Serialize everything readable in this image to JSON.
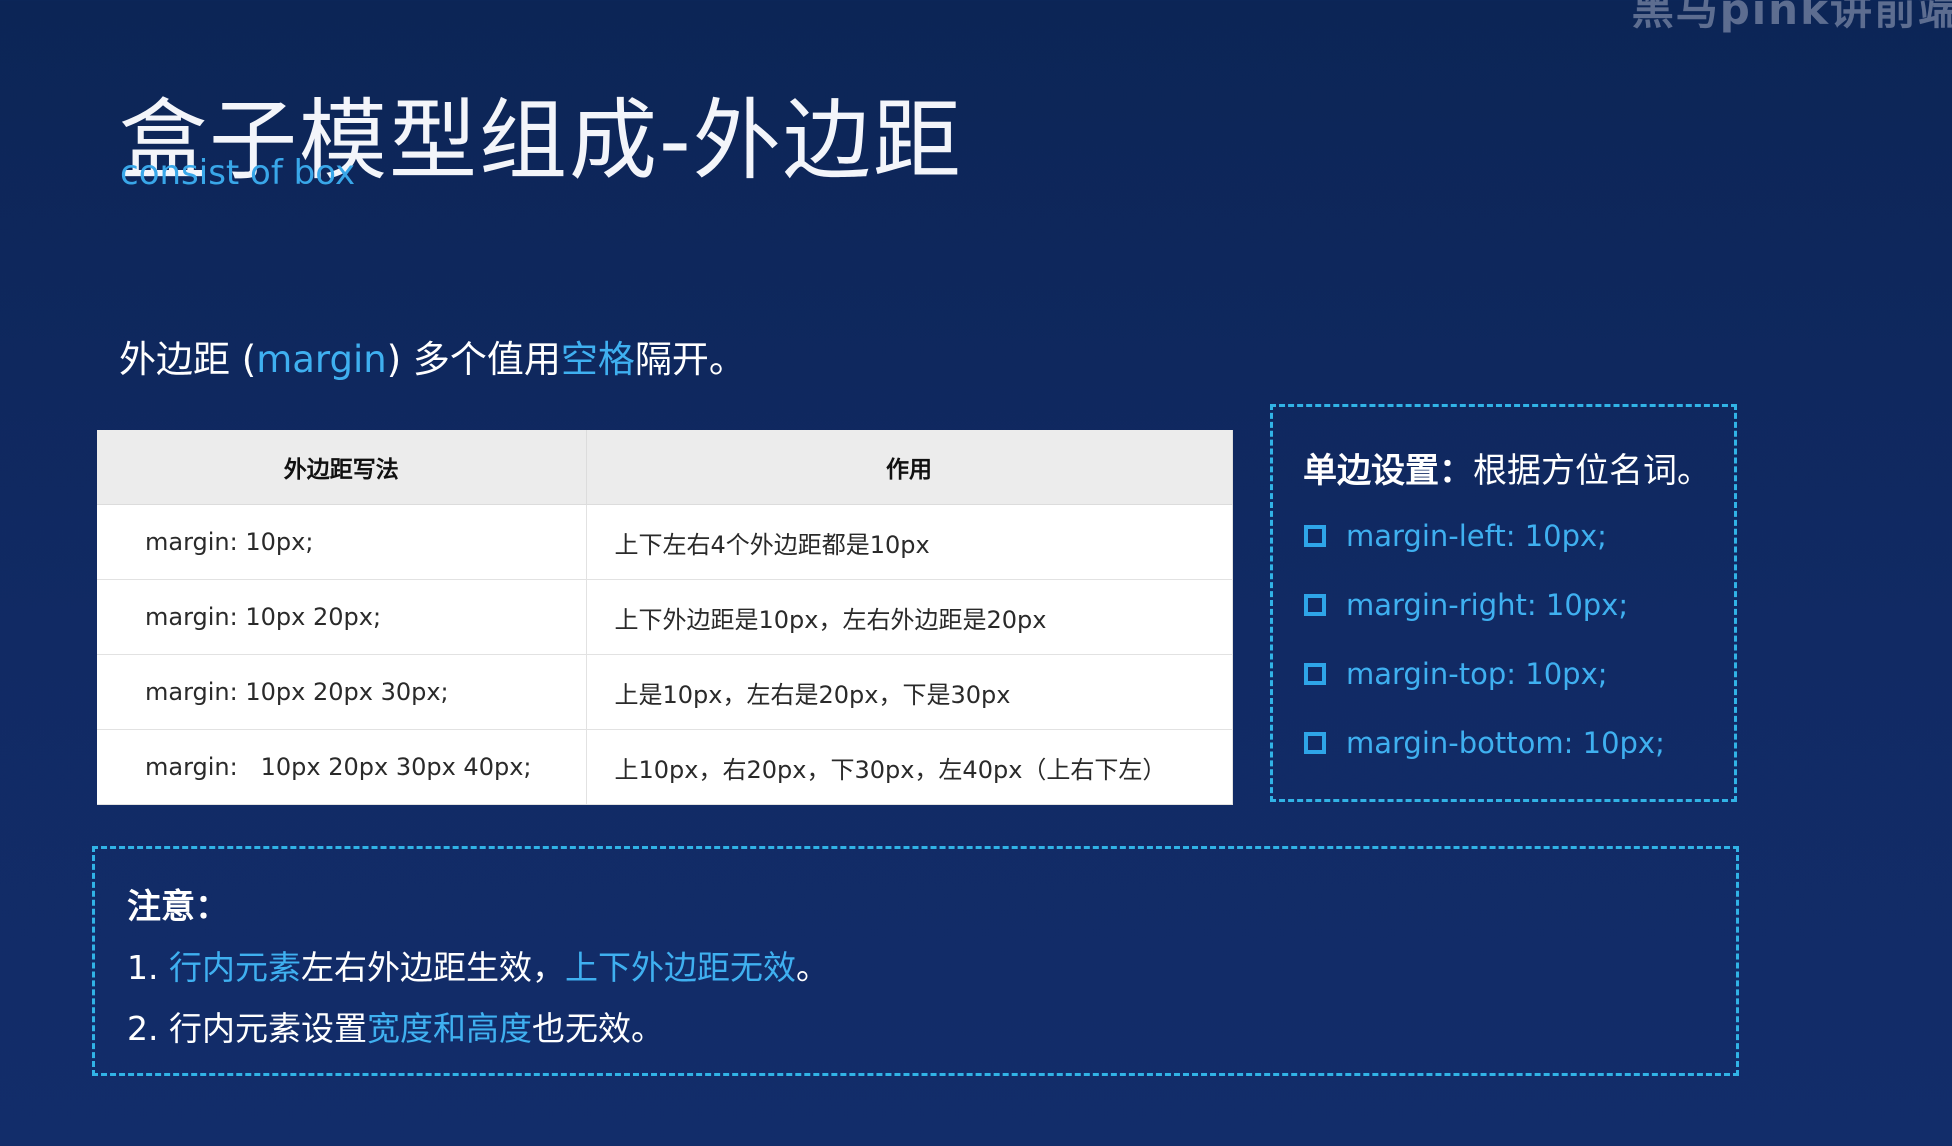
{
  "watermark": "黑马pink讲前端",
  "slide": {
    "title": "盒子模型组成-外边距",
    "subtitle": "consist of box"
  },
  "intro": {
    "before": "外边距 (",
    "keyword": "margin",
    "middle": ") 多个值用",
    "highlight": "空格",
    "after": "隔开。"
  },
  "table": {
    "headers": [
      "外边距写法",
      "作用"
    ],
    "rows": [
      [
        "margin: 10px;",
        "上下左右4个外边距都是10px"
      ],
      [
        "margin: 10px 20px;",
        "上下外边距是10px，左右外边距是20px"
      ],
      [
        "margin: 10px 20px 30px;",
        "上是10px，左右是20px，下是30px"
      ],
      [
        "margin:   10px 20px 30px 40px;",
        "上10px，右20px，下30px，左40px（上右下左）"
      ]
    ]
  },
  "side_box": {
    "title_bold": "单边设置：",
    "title_rest": "根据方位名词。",
    "items": [
      "margin-left: 10px;",
      "margin-right: 10px;",
      "margin-top: 10px;",
      "margin-bottom: 10px;"
    ]
  },
  "note": {
    "title": "注意：",
    "line1": {
      "num": "1. ",
      "hl1": "行内元素",
      "mid": "左右外边距生效，",
      "hl2": "上下外边距无效",
      "end": "。"
    },
    "line2": {
      "num": "2. ",
      "pre": "行内元素设置",
      "hl": "宽度和高度",
      "end": "也无效。"
    }
  },
  "colors": {
    "background": "#112a64",
    "accent": "#3fb0f0",
    "dashed_border": "#31b3e6",
    "table_header": "#ececec"
  },
  "icons": {
    "bullet": "square-bullet-icon"
  }
}
